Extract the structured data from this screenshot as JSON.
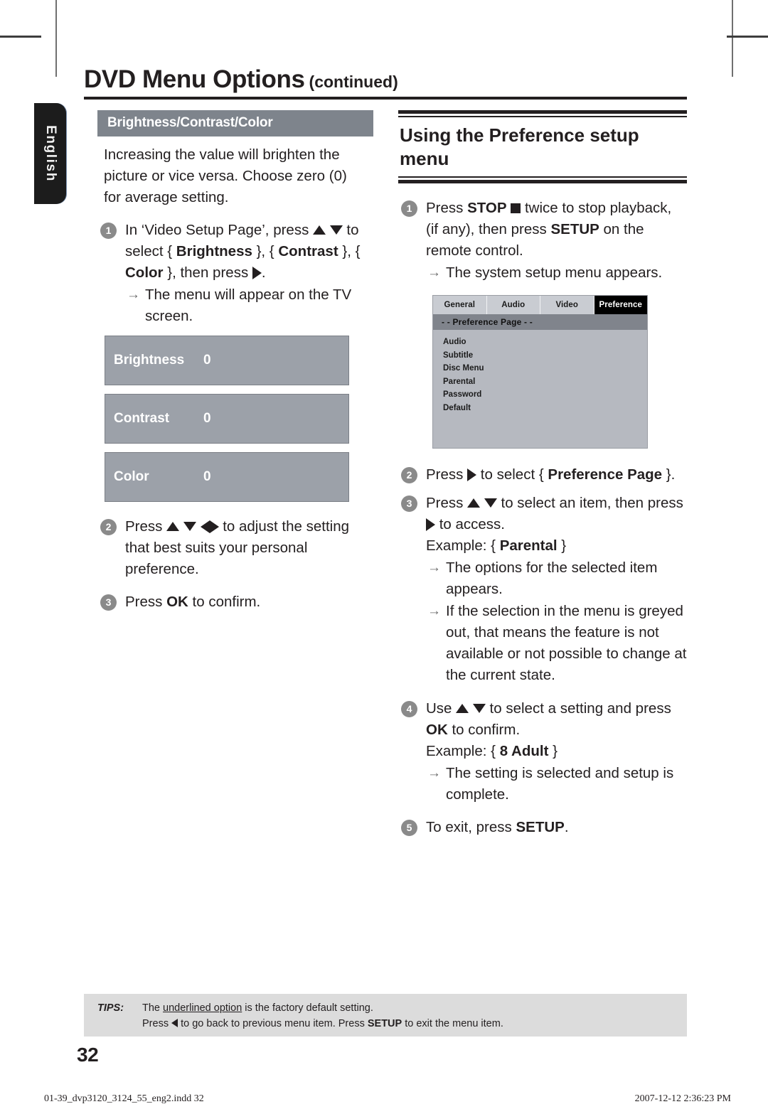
{
  "language_tab": {
    "label": "English"
  },
  "header": {
    "title": "DVD Menu Options",
    "continued": "(continued)"
  },
  "left_column": {
    "section_title": "Brightness/Contrast/Color",
    "intro": "Increasing the value will brighten the picture or vice versa. Choose zero (0) for average setting.",
    "steps": [
      {
        "num": "1",
        "text_a": "In ‘Video Setup Page’, press ",
        "text_b": " to select { ",
        "bold_1": "Brightness",
        "text_c": " }, { ",
        "bold_2": "Contrast",
        "text_d": " }, { ",
        "bold_3": "Color",
        "text_e": " }, then press ",
        "text_f": ".",
        "result": "The menu will appear on the TV screen."
      },
      {
        "num": "2",
        "text_a": "Press ",
        "text_b": " to adjust the setting that best suits your personal preference."
      },
      {
        "num": "3",
        "text_a": "Press ",
        "bold_1": "OK",
        "text_b": " to confirm."
      }
    ],
    "osd_bars": [
      {
        "label": "Brightness",
        "value": "0"
      },
      {
        "label": "Contrast",
        "value": "0"
      },
      {
        "label": "Color",
        "value": "0"
      }
    ]
  },
  "right_column": {
    "heading": "Using the Preference setup menu",
    "steps": [
      {
        "num": "1",
        "text_a": "Press ",
        "bold_1": "STOP",
        "text_b": " twice to stop playback, (if any), then press ",
        "bold_2": "SETUP",
        "text_c": " on the remote control.",
        "result": "The system setup menu appears."
      },
      {
        "num": "2",
        "text_a": "Press ",
        "text_b": " to select { ",
        "bold_1": "Preference Page",
        "text_c": " }."
      },
      {
        "num": "3",
        "text_a": "Press ",
        "text_b": " to select an item, then press ",
        "text_c": " to access.",
        "example_label": "Example: { ",
        "example_bold": "Parental",
        "example_close": " }",
        "result_1": "The options for the selected item appears.",
        "result_2": "If the selection in the menu is greyed out, that means the feature is not available or not possible to change at the current state."
      },
      {
        "num": "4",
        "text_a": "Use ",
        "text_b": " to select a setting and press ",
        "bold_1": "OK",
        "text_c": " to confirm.",
        "example_label": "Example: { ",
        "example_bold": "8 Adult",
        "example_close": " }",
        "result_1": "The setting is selected and setup is complete."
      },
      {
        "num": "5",
        "text_a": "To exit, press ",
        "bold_1": "SETUP",
        "text_b": "."
      }
    ],
    "setup_screen": {
      "tabs": [
        {
          "label": "General",
          "active": false
        },
        {
          "label": "Audio",
          "active": false
        },
        {
          "label": "Video",
          "active": false
        },
        {
          "label": "Preference",
          "active": true
        }
      ],
      "page_title": "- -  Preference Page  - -",
      "items": [
        "Audio",
        "Subtitle",
        "Disc Menu",
        "Parental",
        "Password",
        "Default"
      ]
    }
  },
  "tips": {
    "label": "TIPS:",
    "line1_a": "The ",
    "line1_underline": "underlined option",
    "line1_b": " is the factory default setting.",
    "line2_a": "Press ",
    "line2_b": " to go back to previous menu item. Press ",
    "line2_bold": "SETUP",
    "line2_c": " to exit the menu item."
  },
  "page_number": "32",
  "print_footer": {
    "left": "01-39_dvp3120_3124_55_eng2.indd   32",
    "right": "2007-12-12   2:36:23 PM"
  },
  "colors": {
    "banner_gray": "#7e848c",
    "osd_gray": "#9ca1a9",
    "tips_gray": "#dcdcdc",
    "tab_black": "#1c1c1c",
    "text": "#231f20"
  }
}
